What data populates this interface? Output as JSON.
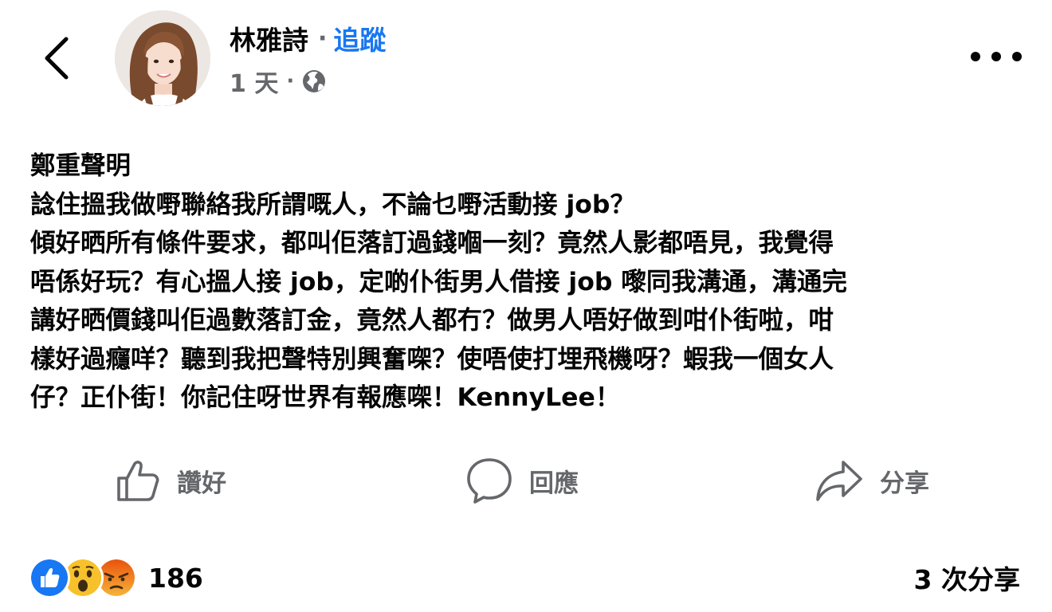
{
  "header": {
    "author_name": "林雅詩",
    "separator": "·",
    "follow_label": "追蹤",
    "post_time": "1 天",
    "meta_separator": "·",
    "audience_icon": "globe-icon",
    "back_icon": "chevron-left-icon",
    "more_icon": "more-horizontal-icon"
  },
  "post": {
    "lines": [
      "鄭重聲明",
      "諗住搵我做嘢聯絡我所謂嘅人，不論乜嘢活動接 job？",
      "傾好晒所有條件要求，都叫佢落訂過錢嗰一刻？竟然人影都唔見，我覺得",
      "唔係好玩？有心搵人接 job，定啲仆街男人借接 job 嚟同我溝通，溝通完",
      "講好晒價錢叫佢過數落訂金，竟然人都冇？做男人唔好做到咁仆街啦，咁",
      "樣好過癮咩？聽到我把聲特別興奮㗎？使唔使打埋飛機呀？蝦我一個女人",
      "仔？正仆街！你記住呀世界有報應㗎！KennyLee！"
    ]
  },
  "actions": {
    "like_label": "讚好",
    "comment_label": "回應",
    "share_label": "分享",
    "like_icon": "thumbs-up-icon",
    "comment_icon": "comment-bubble-icon",
    "share_icon": "share-arrow-icon"
  },
  "footer": {
    "reaction_icons": [
      "like-reaction-icon",
      "wow-reaction-icon",
      "angry-reaction-icon"
    ],
    "reaction_count": "186",
    "share_count": "3 次分享"
  },
  "colors": {
    "text_primary": "#050505",
    "text_secondary": "#65676b",
    "accent_blue": "#1877f2",
    "wow_yellow": "#f7c12b",
    "angry_red": "#e9530d"
  }
}
